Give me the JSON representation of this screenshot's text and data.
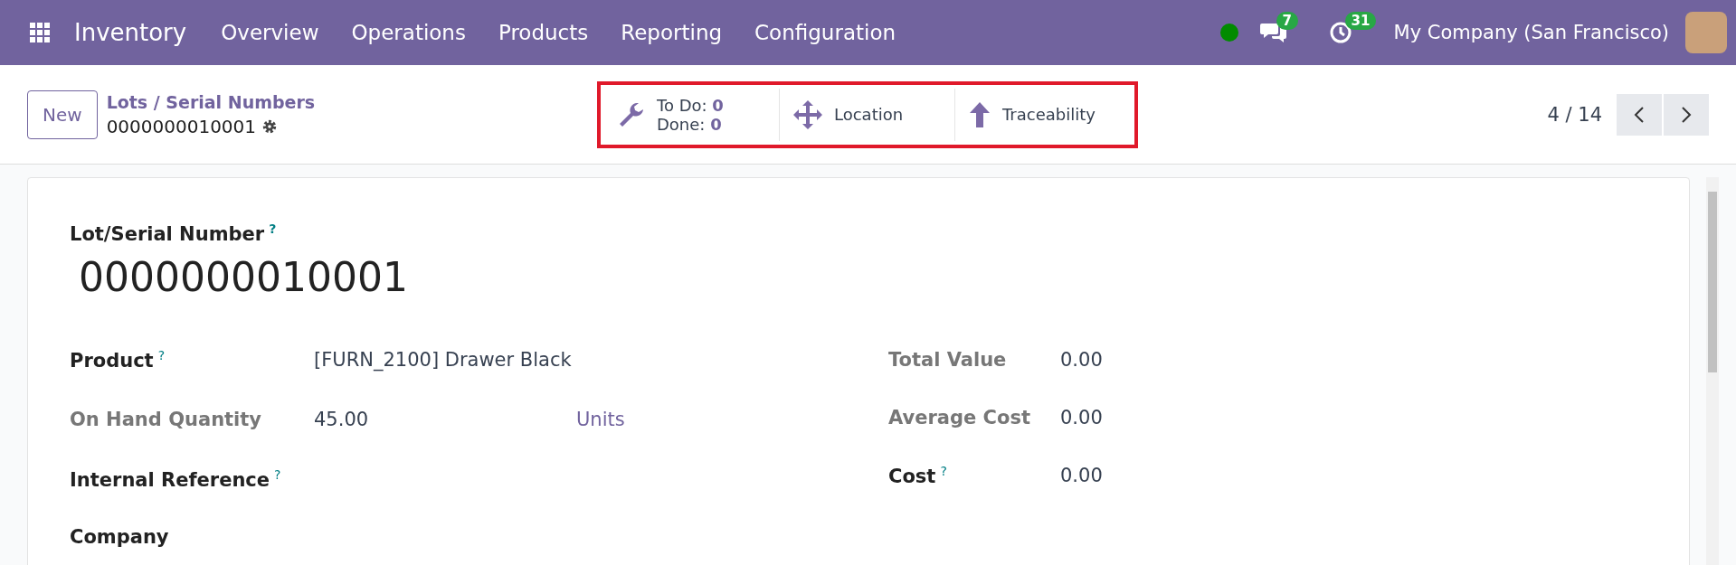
{
  "navbar": {
    "app_name": "Inventory",
    "menu": [
      "Overview",
      "Operations",
      "Products",
      "Reporting",
      "Configuration"
    ],
    "status_online": true,
    "messages_count": "7",
    "activities_count": "31",
    "company": "My Company (San Francisco)"
  },
  "control_panel": {
    "new_button": "New",
    "breadcrumb": "Lots / Serial Numbers",
    "record_name": "0000000010001",
    "pager": "4 / 14"
  },
  "smart_buttons": [
    {
      "kind": "todo",
      "label_1": "To Do:",
      "value_1": "0",
      "label_2": "Done:",
      "value_2": "0"
    },
    {
      "kind": "location",
      "label": "Location"
    },
    {
      "kind": "traceability",
      "label": "Traceability"
    }
  ],
  "form": {
    "title_label": "Lot/Serial Number",
    "title_help": "?",
    "title_value": "0000000010001",
    "left_fields": [
      {
        "label": "Product",
        "help": "?",
        "bold": true,
        "value": "[FURN_2100] Drawer Black"
      },
      {
        "label": "On Hand Quantity",
        "bold": false,
        "value": "45.00",
        "unit": "Units"
      },
      {
        "label": "Internal Reference",
        "help": "?",
        "bold": true
      },
      {
        "label": "Company",
        "bold": true
      }
    ],
    "right_fields": [
      {
        "label": "Total Value",
        "bold": false,
        "value": "0.00"
      },
      {
        "label": "Average Cost",
        "bold": false,
        "value": "0.00"
      },
      {
        "label": "Cost",
        "help": "?",
        "bold": true,
        "value": "0.00"
      }
    ]
  }
}
